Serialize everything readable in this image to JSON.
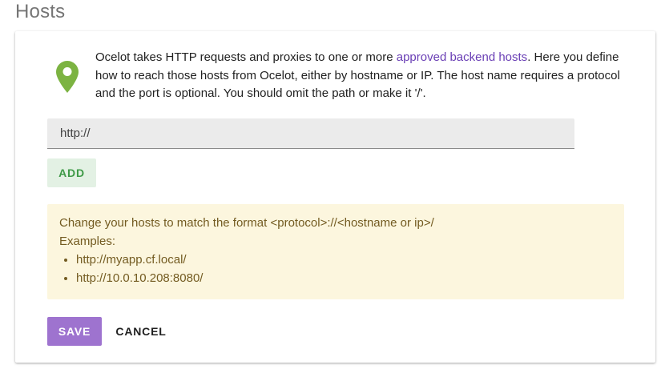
{
  "page": {
    "title": "Hosts"
  },
  "intro": {
    "icon": "map-pin-icon",
    "icon_color": "#7cb342",
    "text_before_link": "Ocelot takes HTTP requests and proxies to one or more ",
    "link_text": "approved backend hosts",
    "text_after_link": ". Here you define how to reach those hosts from Ocelot, either by hostname or IP. The host name requires a protocol and the port is optional. You should omit the path or make it '/'."
  },
  "host_input": {
    "value": "http://"
  },
  "add_button": {
    "label": "ADD"
  },
  "warning": {
    "message": "Change your hosts to match the format <protocol>://<hostname or ip>/",
    "examples_label": "Examples:",
    "examples": [
      "http://myapp.cf.local/",
      "http://10.0.10.208:8080/"
    ]
  },
  "actions": {
    "save_label": "SAVE",
    "cancel_label": "CANCEL"
  },
  "colors": {
    "accent": "#9e73cf",
    "link": "#6a3fb5",
    "success": "#3e9a47",
    "warning_bg": "#fcf6de",
    "warning_text": "#735b21"
  }
}
